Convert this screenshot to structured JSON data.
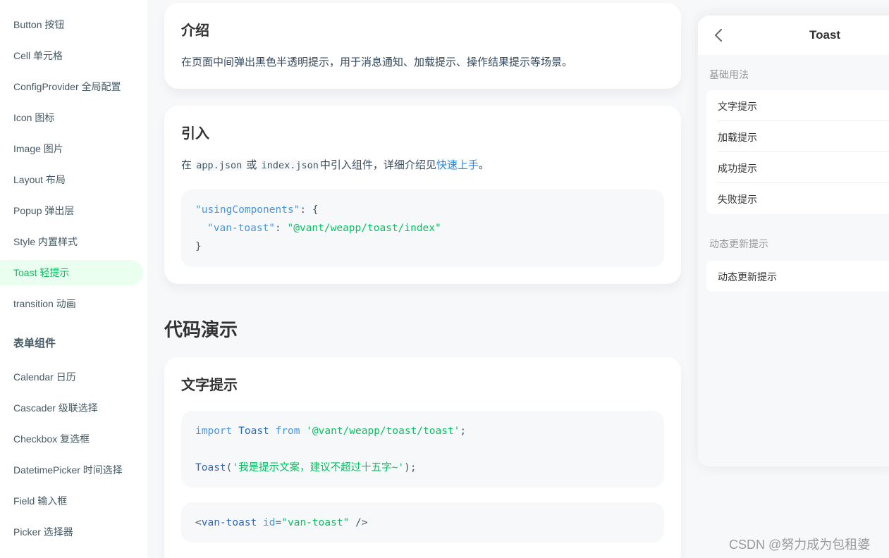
{
  "sidebar": {
    "items": [
      {
        "label": "Button 按钮"
      },
      {
        "label": "Cell 单元格"
      },
      {
        "label": "ConfigProvider 全局配置"
      },
      {
        "label": "Icon 图标"
      },
      {
        "label": "Image 图片"
      },
      {
        "label": "Layout 布局"
      },
      {
        "label": "Popup 弹出层"
      },
      {
        "label": "Style 内置样式"
      },
      {
        "label": "Toast 轻提示",
        "active": true
      },
      {
        "label": "transition 动画"
      }
    ],
    "group_title": "表单组件",
    "form_items": [
      {
        "label": "Calendar 日历"
      },
      {
        "label": "Cascader 级联选择"
      },
      {
        "label": "Checkbox 复选框"
      },
      {
        "label": "DatetimePicker 时间选择"
      },
      {
        "label": "Field 输入框"
      },
      {
        "label": "Picker 选择器"
      }
    ]
  },
  "intro": {
    "title": "介绍",
    "text": "在页面中间弹出黑色半透明提示，用于消息通知、加载提示、操作结果提示等场景。"
  },
  "import": {
    "title": "引入",
    "text_prefix": "在",
    "code1": "app.json",
    "text_or": "或",
    "code2": "index.json",
    "text_mid": "中引入组件，详细介绍见",
    "link": "快速上手",
    "text_suffix": "。",
    "code": {
      "line1_key": "\"usingComponents\"",
      "line1_rest": ": {",
      "line2_key": "\"van-toast\"",
      "line2_sep": ": ",
      "line2_val": "\"@vant/weapp/toast/index\"",
      "line3": "}"
    }
  },
  "demo_section_title": "代码演示",
  "text_demo": {
    "title": "文字提示",
    "code": {
      "kw_import": "import",
      "name": "Toast",
      "kw_from": "from",
      "path": "'@vant/weapp/toast/toast'",
      "semi": ";",
      "call_fn": "Toast",
      "call_open": "(",
      "call_arg": "'我是提示文案，建议不超过十五字~'",
      "call_close": ");"
    },
    "code2": {
      "open": "<",
      "tag": "van-toast",
      "attr": "id",
      "eq": "=",
      "val": "\"van-toast\"",
      "close": " />"
    }
  },
  "phone": {
    "title": "Toast",
    "group1_title": "基础用法",
    "group1_items": [
      "文字提示",
      "加载提示",
      "成功提示",
      "失败提示"
    ],
    "group2_title": "动态更新提示",
    "group2_items": [
      "动态更新提示"
    ]
  },
  "watermark": "CSDN @努力成为包租婆"
}
